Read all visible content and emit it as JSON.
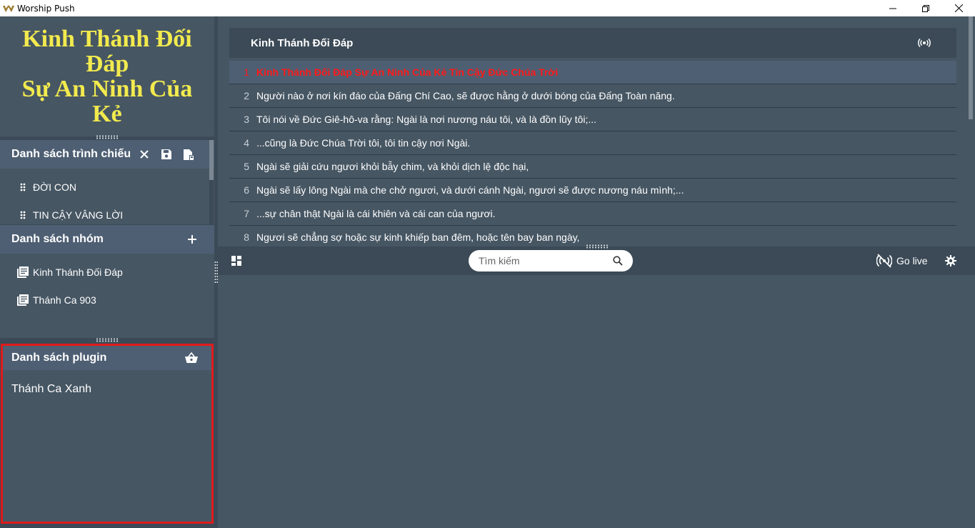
{
  "window": {
    "title": "Worship Push"
  },
  "song_title": {
    "lines": [
      "Kinh Thánh Đối",
      "Đáp",
      "Sự An Ninh Của",
      "Kẻ"
    ]
  },
  "playlist": {
    "title": "Danh sách trình chiếu",
    "items": [
      {
        "label": "ĐỜI CON"
      },
      {
        "label": "TIN CẬY VÂNG LỜI"
      }
    ]
  },
  "groups": {
    "title": "Danh sách nhóm",
    "items": [
      {
        "label": "Kinh Thánh Đối Đáp"
      },
      {
        "label": "Thánh Ca 903"
      }
    ]
  },
  "plugins": {
    "title": "Danh sách plugin",
    "items": [
      {
        "label": "Thánh Ca Xanh"
      }
    ]
  },
  "verses": {
    "title": "Kinh Thánh Đối Đáp",
    "active_index": 0,
    "rows": [
      {
        "num": "1",
        "text": "Kinh Thánh Đối Đáp Sự An Ninh Của Kẻ Tin Cậy Đức Chúa Trời"
      },
      {
        "num": "2",
        "text": "Người nào ở nơi kín đáo của Đấng Chí Cao, sẽ được hằng ở dưới bóng của Đấng Toàn năng."
      },
      {
        "num": "3",
        "text": "Tôi nói về Đức Giê-hô-va rằng: Ngài là nơi nương náu tôi, và là đồn lũy tôi;..."
      },
      {
        "num": "4",
        "text": "...cũng là Đức Chúa Trời tôi, tôi tin cậy nơi Ngài."
      },
      {
        "num": "5",
        "text": "Ngài sẽ giải cứu ngươi khỏi bẫy chim, và khỏi dịch lệ độc hại,"
      },
      {
        "num": "6",
        "text": "Ngài sẽ lấy lông Ngài mà che chở ngươi, và dưới cánh Ngài, ngươi sẽ được nương náu mình;..."
      },
      {
        "num": "7",
        "text": "...sự chân thật Ngài là cái khiên và cái can của ngươi."
      },
      {
        "num": "8",
        "text": "Ngươi sẽ chẳng sợ hoặc sự kinh khiếp ban đêm, hoặc tên bay ban ngày,"
      }
    ]
  },
  "toolbar": {
    "search_placeholder": "Tìm kiếm",
    "golive_label": "Go live"
  },
  "colors": {
    "accent_title": "#f2ea4e",
    "active_verse": "#ff1a1a",
    "highlight_border": "#e01b1b"
  }
}
